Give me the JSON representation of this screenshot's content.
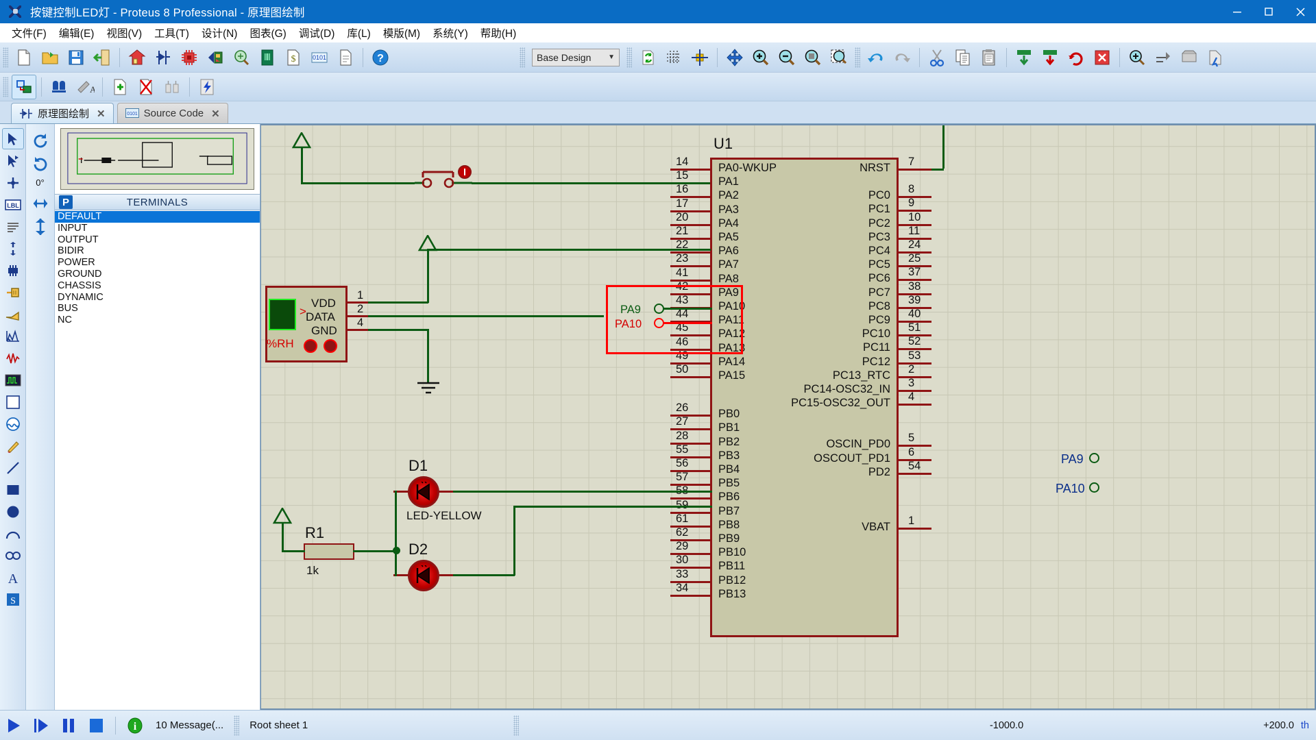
{
  "window": {
    "title": "按键控制LED灯 - Proteus 8 Professional - 原理图绘制",
    "app_icon": "proteus-logo-icon",
    "minimize_label": "—",
    "maximize_label": "❐",
    "close_label": "✕"
  },
  "menu": {
    "items": [
      {
        "label": "文件(F)",
        "name": "menu-file"
      },
      {
        "label": "编辑(E)",
        "name": "menu-edit"
      },
      {
        "label": "视图(V)",
        "name": "menu-view"
      },
      {
        "label": "工具(T)",
        "name": "menu-tools"
      },
      {
        "label": "设计(N)",
        "name": "menu-design"
      },
      {
        "label": "图表(G)",
        "name": "menu-graph"
      },
      {
        "label": "调试(D)",
        "name": "menu-debug"
      },
      {
        "label": "库(L)",
        "name": "menu-library"
      },
      {
        "label": "模版(M)",
        "name": "menu-template"
      },
      {
        "label": "系统(Y)",
        "name": "menu-system"
      },
      {
        "label": "帮助(H)",
        "name": "menu-help"
      }
    ]
  },
  "toolbar": {
    "design_selector_value": "Base Design",
    "icons_row1": [
      "new-file-icon",
      "open-folder-icon",
      "save-icon",
      "exit-icon",
      "home-icon",
      "schematic-capture-icon",
      "pcb-layout-icon",
      "3d-view-icon",
      "bill-of-materials-icon",
      "design-explorer-icon",
      "bom-report-icon",
      "source-code-icon",
      "project-notes-icon",
      "help-icon"
    ],
    "icons_row2": [
      "component-mode-icon",
      "find-icon",
      "property-assignment-icon",
      "new-sheet-icon",
      "remove-sheet-icon",
      "exit-sheet-icon",
      "power-rail-icon"
    ],
    "icons_view": [
      "refresh-icon",
      "toggle-grid-icon",
      "origin-icon",
      "pan-icon",
      "zoom-in-icon",
      "zoom-out-icon",
      "zoom-to-fit-icon",
      "zoom-area-icon"
    ],
    "icons_edit": [
      "undo-icon",
      "redo-icon",
      "cut-icon",
      "copy-icon",
      "paste-icon"
    ],
    "icons_block": [
      "block-copy-icon",
      "block-move-icon",
      "block-rotate-icon",
      "block-delete-icon",
      "pick-device-icon",
      "make-device-icon",
      "packaging-tool-icon",
      "decompose-icon"
    ]
  },
  "tabs": [
    {
      "label": "原理图绘制",
      "icon": "schematic-icon",
      "active": true,
      "close": "✕"
    },
    {
      "label": "Source Code",
      "icon": "source-code-icon",
      "active": false,
      "close": "✕"
    }
  ],
  "left_tools": {
    "items": [
      {
        "name": "selection-mode-icon",
        "label": "Selection Mode"
      },
      {
        "name": "component-mode-icon",
        "label": "Component Mode"
      },
      {
        "name": "junction-dot-icon",
        "label": "Junction Dot Mode"
      },
      {
        "name": "wire-label-icon",
        "label": "Wire Label Mode"
      },
      {
        "name": "text-script-icon",
        "label": "Text Script Mode"
      },
      {
        "name": "buses-icon",
        "label": "Buses Mode"
      },
      {
        "name": "subcircuit-icon",
        "label": "Subcircuit Mode"
      },
      {
        "name": "terminals-icon",
        "label": "Terminals Mode"
      },
      {
        "name": "device-pin-icon",
        "label": "Device Pin Mode"
      },
      {
        "name": "graph-icon",
        "label": "Graph Mode"
      },
      {
        "name": "tape-recorder-icon",
        "label": "Tape Recorder Mode"
      },
      {
        "name": "generator-icon",
        "label": "Generator Mode"
      },
      {
        "name": "voltage-probe-icon",
        "label": "Voltage Probe Mode"
      },
      {
        "name": "current-probe-icon",
        "label": "Current Probe Mode"
      },
      {
        "name": "virtual-instrument-icon",
        "label": "Virtual Instruments Mode"
      },
      {
        "name": "line-tool-icon",
        "label": "2D Graphics Line"
      },
      {
        "name": "box-tool-icon",
        "label": "2D Graphics Box"
      },
      {
        "name": "circle-tool-icon",
        "label": "2D Graphics Circle"
      },
      {
        "name": "arc-tool-icon",
        "label": "2D Graphics Arc"
      },
      {
        "name": "path-tool-icon",
        "label": "2D Graphics Path"
      },
      {
        "name": "text-tool-icon",
        "label": "2D Graphics Text"
      },
      {
        "name": "symbol-tool-icon",
        "label": "2D Graphics Symbol"
      }
    ]
  },
  "orientation": {
    "rotate_cw_icon": "rotate-clockwise-icon",
    "rotate_ccw_icon": "rotate-counterclockwise-icon",
    "angle_label": "0°",
    "mirror_x_icon": "mirror-horizontal-icon",
    "mirror_y_icon": "mirror-vertical-icon"
  },
  "panel": {
    "badge": "P",
    "title": "TERMINALS",
    "items": [
      {
        "label": "DEFAULT",
        "selected": true
      },
      {
        "label": "INPUT",
        "selected": false
      },
      {
        "label": "OUTPUT",
        "selected": false
      },
      {
        "label": "BIDIR",
        "selected": false
      },
      {
        "label": "POWER",
        "selected": false
      },
      {
        "label": "GROUND",
        "selected": false
      },
      {
        "label": "CHASSIS",
        "selected": false
      },
      {
        "label": "DYNAMIC",
        "selected": false
      },
      {
        "label": "BUS",
        "selected": false
      },
      {
        "label": "NC",
        "selected": false
      }
    ]
  },
  "schematic": {
    "ic": {
      "reference": "U1",
      "left_pins": [
        {
          "num": "14",
          "name": "PA0-WKUP"
        },
        {
          "num": "15",
          "name": "PA1"
        },
        {
          "num": "16",
          "name": "PA2"
        },
        {
          "num": "17",
          "name": "PA3"
        },
        {
          "num": "20",
          "name": "PA4"
        },
        {
          "num": "21",
          "name": "PA5"
        },
        {
          "num": "22",
          "name": "PA6"
        },
        {
          "num": "23",
          "name": "PA7"
        },
        {
          "num": "41",
          "name": "PA8"
        },
        {
          "num": "42",
          "name": "PA9"
        },
        {
          "num": "43",
          "name": "PA10"
        },
        {
          "num": "44",
          "name": "PA11"
        },
        {
          "num": "45",
          "name": "PA12"
        },
        {
          "num": "46",
          "name": "PA13"
        },
        {
          "num": "49",
          "name": "PA14"
        },
        {
          "num": "50",
          "name": "PA15"
        },
        {
          "num": "26",
          "name": "PB0"
        },
        {
          "num": "27",
          "name": "PB1"
        },
        {
          "num": "28",
          "name": "PB2"
        },
        {
          "num": "55",
          "name": "PB3"
        },
        {
          "num": "56",
          "name": "PB4"
        },
        {
          "num": "57",
          "name": "PB5"
        },
        {
          "num": "58",
          "name": "PB6"
        },
        {
          "num": "59",
          "name": "PB7"
        },
        {
          "num": "61",
          "name": "PB8"
        },
        {
          "num": "62",
          "name": "PB9"
        },
        {
          "num": "29",
          "name": "PB10"
        },
        {
          "num": "30",
          "name": "PB11"
        },
        {
          "num": "33",
          "name": "PB12"
        },
        {
          "num": "34",
          "name": "PB13"
        }
      ],
      "right_pins": [
        {
          "num": "7",
          "name": "NRST"
        },
        {
          "num": "8",
          "name": "PC0"
        },
        {
          "num": "9",
          "name": "PC1"
        },
        {
          "num": "10",
          "name": "PC2"
        },
        {
          "num": "11",
          "name": "PC3"
        },
        {
          "num": "24",
          "name": "PC4"
        },
        {
          "num": "25",
          "name": "PC5"
        },
        {
          "num": "37",
          "name": "PC6"
        },
        {
          "num": "38",
          "name": "PC7"
        },
        {
          "num": "39",
          "name": "PC8"
        },
        {
          "num": "40",
          "name": "PC9"
        },
        {
          "num": "51",
          "name": "PC10"
        },
        {
          "num": "52",
          "name": "PC11"
        },
        {
          "num": "53",
          "name": "PC12"
        },
        {
          "num": "2",
          "name": "PC13_RTC"
        },
        {
          "num": "3",
          "name": "PC14-OSC32_IN"
        },
        {
          "num": "4",
          "name": "PC15-OSC32_OUT"
        },
        {
          "num": "5",
          "name": "OSCIN_PD0"
        },
        {
          "num": "6",
          "name": "OSCOUT_PD1"
        },
        {
          "num": "54",
          "name": "PD2"
        },
        {
          "num": "1",
          "name": "VBAT"
        }
      ]
    },
    "sensor": {
      "pins": [
        {
          "num": "1",
          "name": "VDD"
        },
        {
          "num": "2",
          "name": "DATA"
        },
        {
          "num": "4",
          "name": "GND"
        }
      ],
      "unit_label": "%RH",
      "marker": ">"
    },
    "net_labels": [
      {
        "label": "PA9",
        "color": "#0b5b13"
      },
      {
        "label": "PA10",
        "color": "#d40000"
      }
    ],
    "terminals_right": [
      {
        "label": "PA9"
      },
      {
        "label": "PA10"
      }
    ],
    "components": [
      {
        "ref": "D1",
        "value": "LED-YELLOW"
      },
      {
        "ref": "D2",
        "value": ""
      },
      {
        "ref": "R1",
        "value": "1k"
      }
    ]
  },
  "statusbar": {
    "play_icon": "play-icon",
    "step_icon": "step-icon",
    "pause_icon": "pause-icon",
    "stop_icon": "stop-icon",
    "info_icon": "info-icon",
    "messages": "10 Message(...",
    "sheet": "Root sheet 1",
    "coord_x": "-1000.0",
    "coord_y": "+200.0",
    "units": "th"
  }
}
